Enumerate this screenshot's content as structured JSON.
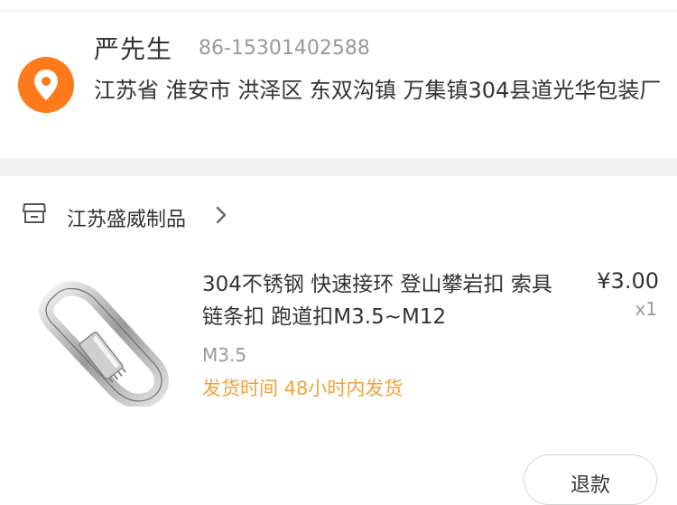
{
  "address": {
    "name": "严先生",
    "phone": "86-15301402588",
    "full_address": "江苏省 淮安市 洪泽区 东双沟镇 万集镇304县道光华包装厂",
    "icon": "location-pin-icon",
    "icon_color": "#ff7a1a"
  },
  "shop": {
    "icon": "store-icon",
    "name": "江苏盛威制品",
    "chevron": "chevron-right-icon"
  },
  "product": {
    "title": "304不锈钢 快速接环 登山攀岩扣 索具链条扣 跑道扣M3.5~M12",
    "price": "¥3.00",
    "quantity": "x1",
    "spec": "M3.5",
    "shipping_label": "发货时间",
    "shipping_value": "48小时内发货",
    "shipping_color": "#f0a238"
  },
  "actions": {
    "refund_label": "退款"
  }
}
